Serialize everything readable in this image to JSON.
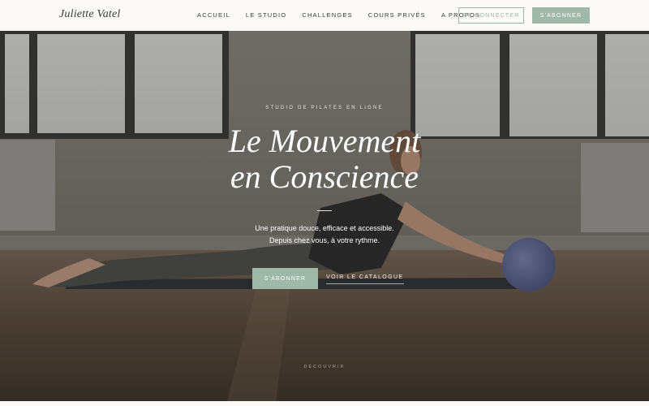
{
  "brand": {
    "logo": "Juliette Vatel"
  },
  "nav": {
    "items": [
      {
        "label": "ACCUEIL"
      },
      {
        "label": "LE STUDIO"
      },
      {
        "label": "CHALLENGES"
      },
      {
        "label": "COURS PRIVÉS"
      },
      {
        "label": "A PROPOS"
      }
    ],
    "login_label": "SE CONNECTER",
    "subscribe_label": "S'ABONNER"
  },
  "hero": {
    "eyebrow": "STUDIO DE PILATES EN LIGNE",
    "title_line1": "Le Mouvement",
    "title_line2": "en Conscience",
    "tagline_line1": "Une pratique douce, efficace et accessible.",
    "tagline_line2": "Depuis chez vous, à votre rythme.",
    "cta_subscribe": "S'ABONNER",
    "cta_catalogue": "VOIR LE CATALOGUE",
    "scroll_hint": "DÉCOUVRIR"
  },
  "colors": {
    "accent": "#9fb8aa",
    "header_bg": "#fbfaf7",
    "text_dark": "#3a3834"
  }
}
